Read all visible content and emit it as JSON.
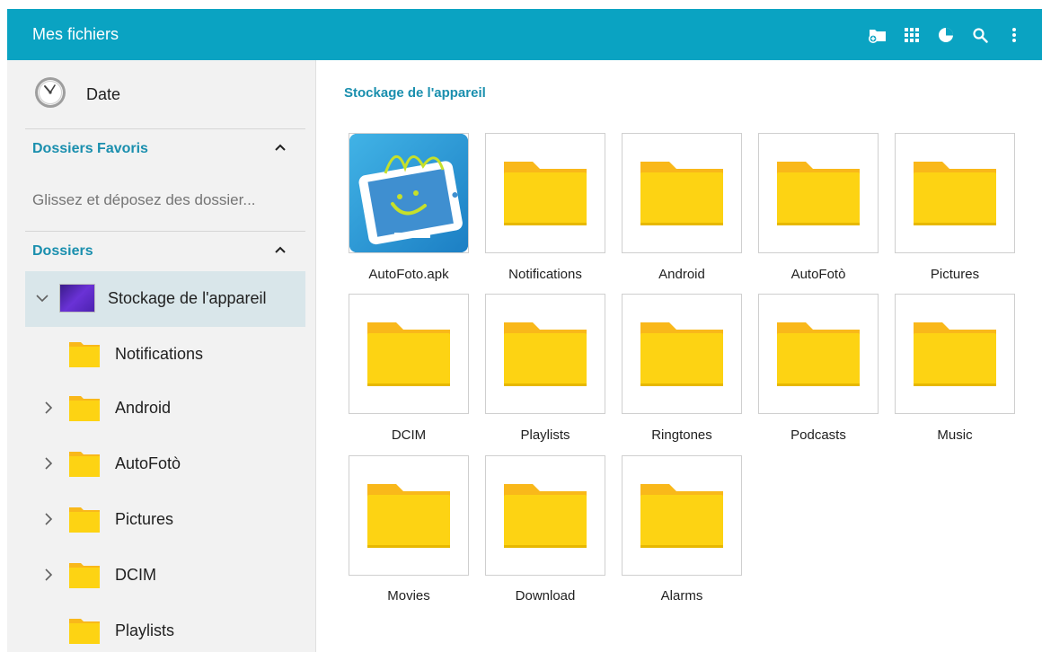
{
  "app": {
    "title": "Mes fichiers",
    "accent_color": "#0aa3c2",
    "actions": [
      {
        "name": "storage-add-icon"
      },
      {
        "name": "grid-view-icon"
      },
      {
        "name": "storage-usage-icon"
      },
      {
        "name": "search-icon"
      },
      {
        "name": "more-options-icon"
      }
    ]
  },
  "sidebar": {
    "date_label": "Date",
    "favorites": {
      "title": "Dossiers Favoris",
      "hint": "Glissez et déposez des dossier..."
    },
    "folders": {
      "title": "Dossiers"
    },
    "storage_label": "Stockage de l'appareil",
    "tree": [
      {
        "label": "Notifications",
        "expandable": false
      },
      {
        "label": "Android",
        "expandable": true
      },
      {
        "label": "AutoFotò",
        "expandable": true
      },
      {
        "label": "Pictures",
        "expandable": true
      },
      {
        "label": "DCIM",
        "expandable": true
      },
      {
        "label": "Playlists",
        "expandable": false
      }
    ]
  },
  "main": {
    "breadcrumb": "Stockage de l'appareil",
    "items": [
      {
        "label": "AutoFoto.apk",
        "type": "apk"
      },
      {
        "label": "Notifications",
        "type": "folder"
      },
      {
        "label": "Android",
        "type": "folder"
      },
      {
        "label": "AutoFotò",
        "type": "folder"
      },
      {
        "label": "Pictures",
        "type": "folder"
      },
      {
        "label": "DCIM",
        "type": "folder"
      },
      {
        "label": "Playlists",
        "type": "folder"
      },
      {
        "label": "Ringtones",
        "type": "folder"
      },
      {
        "label": "Podcasts",
        "type": "folder"
      },
      {
        "label": "Music",
        "type": "folder"
      },
      {
        "label": "Movies",
        "type": "folder"
      },
      {
        "label": "Download",
        "type": "folder"
      },
      {
        "label": "Alarms",
        "type": "folder"
      }
    ]
  }
}
